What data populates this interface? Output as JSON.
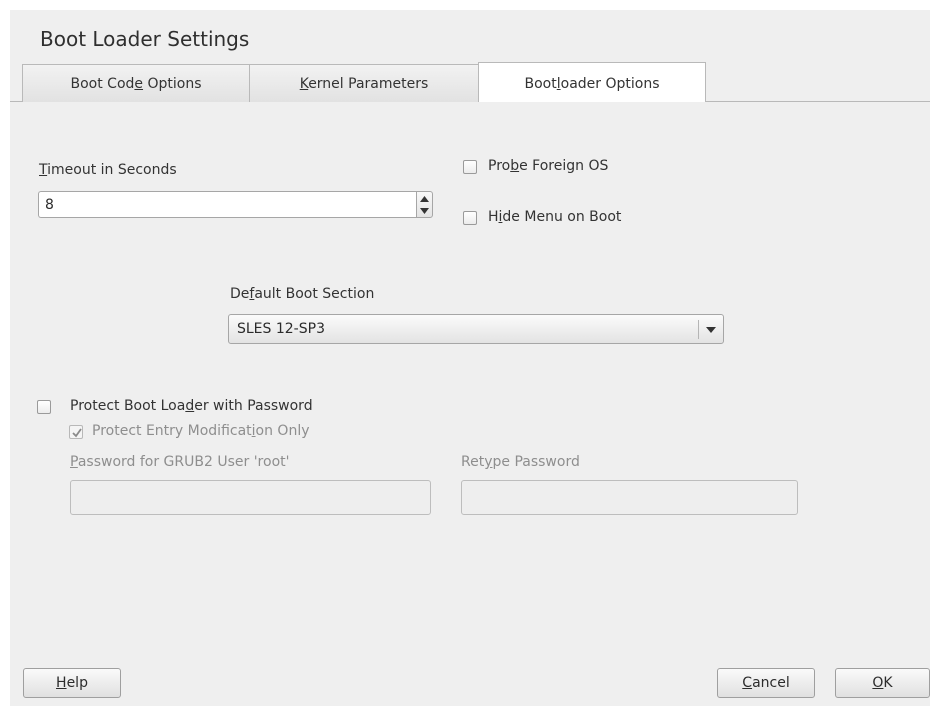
{
  "window": {
    "title": "Boot Loader Settings"
  },
  "tabs": [
    {
      "label": "Boot Code Options",
      "mnemonic_index": 8,
      "active": false
    },
    {
      "label": "Kernel Parameters",
      "mnemonic_index": 0,
      "active": false
    },
    {
      "label": "Bootloader Options",
      "mnemonic_index": 4,
      "active": true
    }
  ],
  "timeout": {
    "label": "Timeout in Seconds",
    "mnemonic_index": 0,
    "value": "8"
  },
  "probe_foreign_os": {
    "label": "Probe Foreign OS",
    "mnemonic_index": 3,
    "checked": false
  },
  "hide_menu": {
    "label": "Hide Menu on Boot",
    "mnemonic_index": 1,
    "checked": false
  },
  "default_boot_section": {
    "label": "Default Boot Section",
    "mnemonic_index": 2,
    "selected": "SLES 12-SP3"
  },
  "password": {
    "protect_label": "Protect Boot Loader with Password",
    "protect_mnemonic_index": 16,
    "protect_checked": false,
    "entry_mod_label": "Protect Entry Modification Only",
    "entry_mod_mnemonic_index": 23,
    "entry_mod_checked": true,
    "grub_password_label": "Password for GRUB2 User 'root'",
    "grub_password_mnemonic_index": 0,
    "retype_label": "Retype Password",
    "retype_mnemonic_index": 3
  },
  "buttons": {
    "help": {
      "label": "Help",
      "mnemonic_index": 0
    },
    "cancel": {
      "label": "Cancel",
      "mnemonic_index": 0
    },
    "ok": {
      "label": "OK",
      "mnemonic_index": 0
    }
  },
  "colors": {
    "window_bg": "#efefef",
    "border": "#a6a6a6",
    "check": "#555555"
  }
}
